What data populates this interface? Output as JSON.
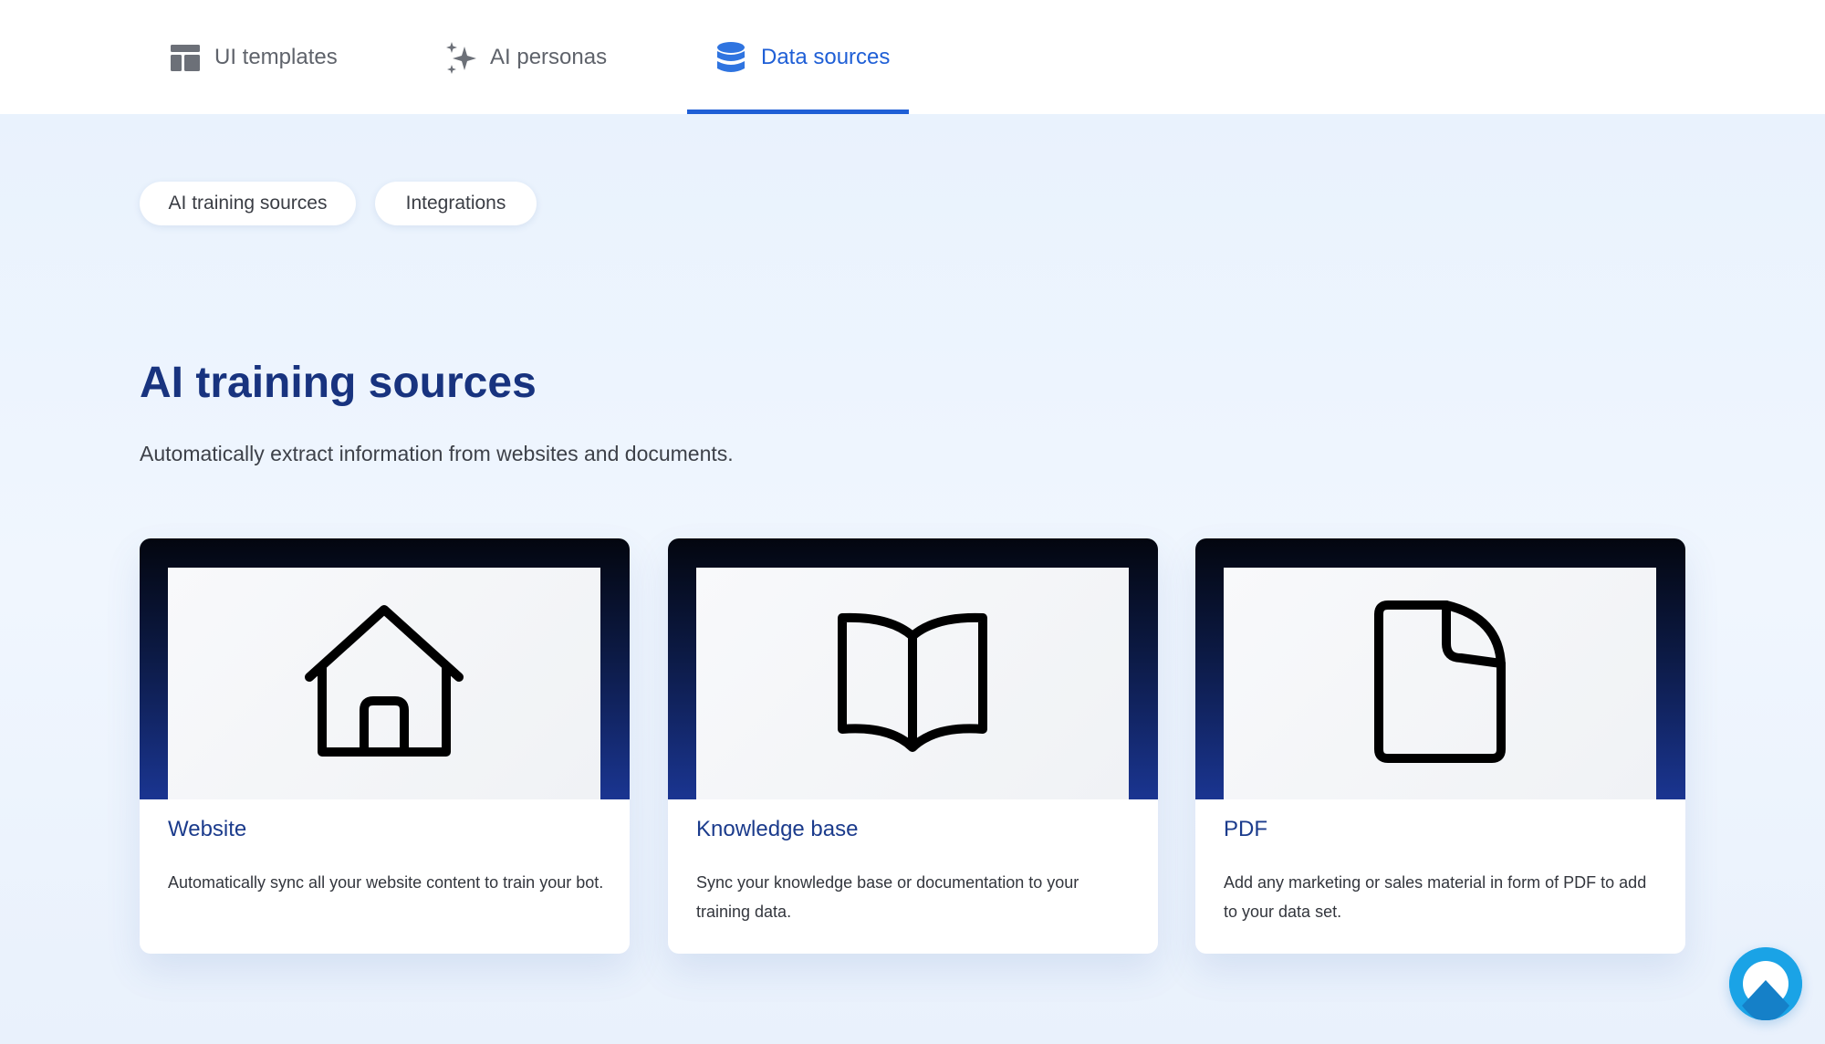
{
  "tabs": [
    {
      "label": "UI templates",
      "icon": "layout-template-icon",
      "active": false
    },
    {
      "label": "AI personas",
      "icon": "sparkles-icon",
      "active": false
    },
    {
      "label": "Data sources",
      "icon": "database-icon",
      "active": true
    }
  ],
  "pills": [
    {
      "label": "AI training sources"
    },
    {
      "label": "Integrations"
    }
  ],
  "section": {
    "title": "AI training sources",
    "subtitle": "Automatically extract information from websites and documents."
  },
  "cards": [
    {
      "title": "Website",
      "description": "Automatically sync all your website content to train your bot.",
      "icon": "home-icon"
    },
    {
      "title": "Knowledge base",
      "description": "Sync your knowledge base or documentation to your training data.",
      "icon": "book-open-icon"
    },
    {
      "title": "PDF",
      "description": "Add any marketing or sales material in form of PDF to add to your data set.",
      "icon": "document-icon"
    }
  ],
  "colors": {
    "accent": "#1f5fd6",
    "heading": "#18337f",
    "chat_bubble": "#1aa3e6"
  }
}
